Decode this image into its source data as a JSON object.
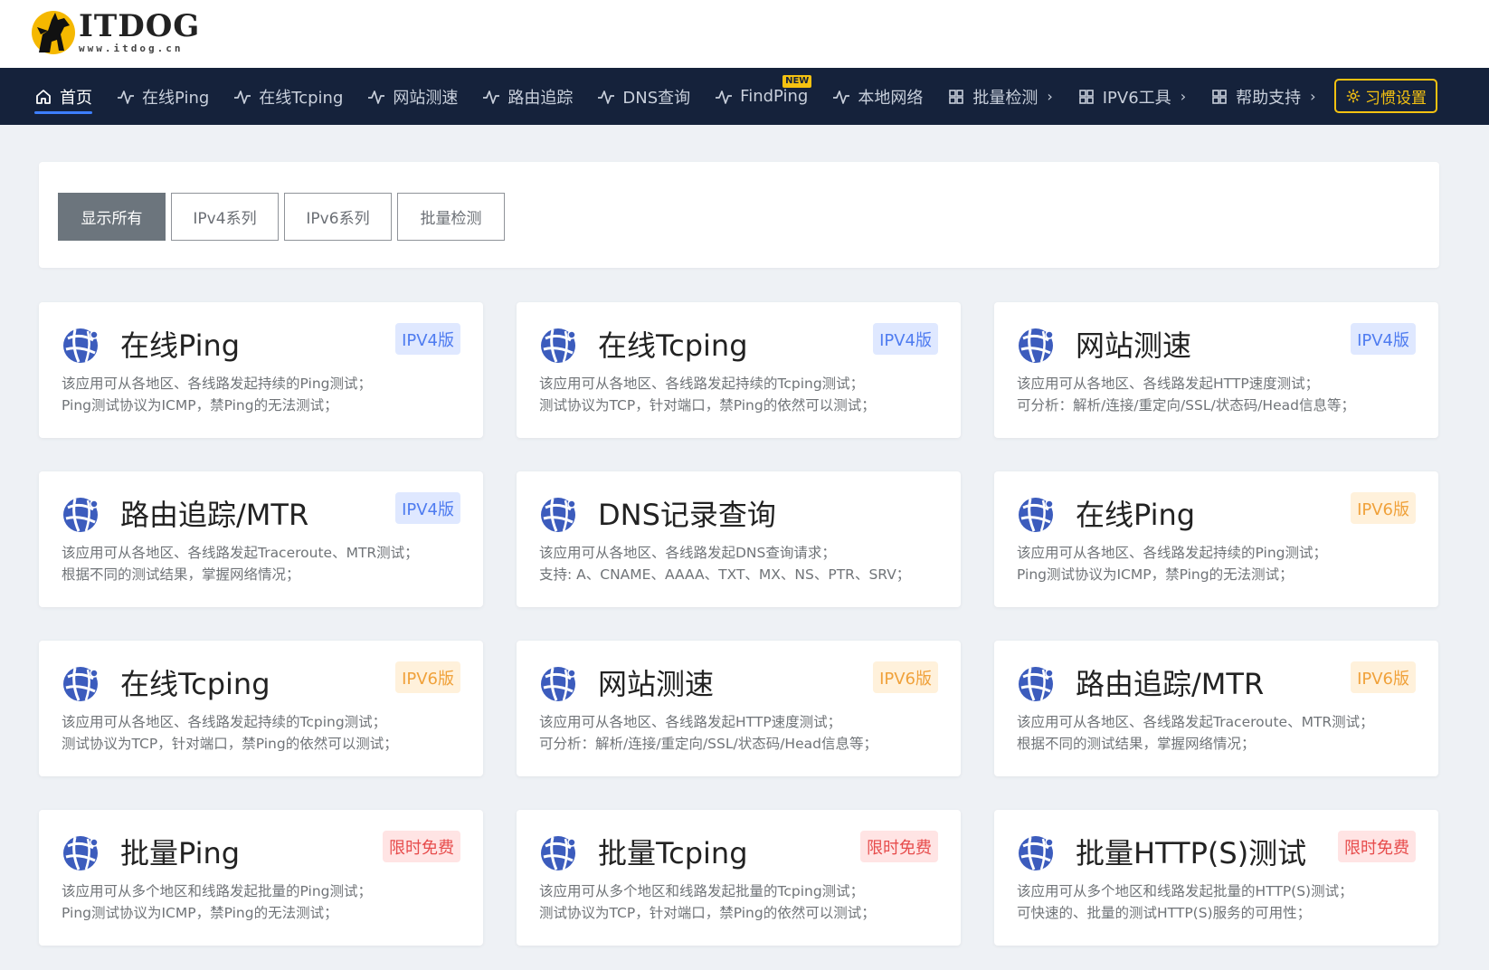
{
  "logo": {
    "name": "ITDOG",
    "domain": "www.itdog.cn"
  },
  "nav": {
    "items": [
      {
        "label": "首页",
        "icon": "home-icon",
        "active": true
      },
      {
        "label": "在线Ping",
        "icon": "pulse-icon"
      },
      {
        "label": "在线Tcping",
        "icon": "pulse-icon"
      },
      {
        "label": "网站测速",
        "icon": "pulse-icon"
      },
      {
        "label": "路由追踪",
        "icon": "pulse-icon"
      },
      {
        "label": "DNS查询",
        "icon": "pulse-icon"
      },
      {
        "label": "FindPing",
        "icon": "pulse-icon",
        "badge": "NEW"
      },
      {
        "label": "本地网络",
        "icon": "pulse-icon"
      },
      {
        "label": "批量检测",
        "icon": "grid-icon",
        "chevron": "›"
      },
      {
        "label": "IPV6工具",
        "icon": "grid-icon",
        "chevron": "›"
      },
      {
        "label": "帮助支持",
        "icon": "grid-icon",
        "chevron": "›"
      }
    ],
    "settings_label": "习惯设置",
    "colors": {
      "bg": "#15223b",
      "accent": "#f5c211",
      "active_underline": "#3d7fff"
    }
  },
  "filters": [
    "显示所有",
    "IPv4系列",
    "IPv6系列",
    "批量检测"
  ],
  "cards": [
    {
      "title": "在线Ping",
      "badge": "IPV4版",
      "type": "v4",
      "desc": [
        "该应用可从各地区、各线路发起持续的Ping测试；",
        "Ping测试协议为ICMP，禁Ping的无法测试；"
      ]
    },
    {
      "title": "在线Tcping",
      "badge": "IPV4版",
      "type": "v4",
      "desc": [
        "该应用可从各地区、各线路发起持续的Tcping测试；",
        "测试协议为TCP，针对端口，禁Ping的依然可以测试；"
      ]
    },
    {
      "title": "网站测速",
      "badge": "IPV4版",
      "type": "v4",
      "desc": [
        "该应用可从各地区、各线路发起HTTP速度测试；",
        "可分析：解析/连接/重定向/SSL/状态码/Head信息等；"
      ]
    },
    {
      "title": "路由追踪/MTR",
      "badge": "IPV4版",
      "type": "v4",
      "desc": [
        "该应用可从各地区、各线路发起Traceroute、MTR测试；",
        "根据不同的测试结果，掌握网络情况；"
      ]
    },
    {
      "title": "DNS记录查询",
      "badge": "",
      "type": "none",
      "desc": [
        "该应用可从各地区、各线路发起DNS查询请求；",
        "支持: A、CNAME、AAAA、TXT、MX、NS、PTR、SRV；"
      ]
    },
    {
      "title": "在线Ping",
      "badge": "IPV6版",
      "type": "v6",
      "desc": [
        "该应用可从各地区、各线路发起持续的Ping测试；",
        "Ping测试协议为ICMP，禁Ping的无法测试；"
      ]
    },
    {
      "title": "在线Tcping",
      "badge": "IPV6版",
      "type": "v6",
      "desc": [
        "该应用可从各地区、各线路发起持续的Tcping测试；",
        "测试协议为TCP，针对端口，禁Ping的依然可以测试；"
      ]
    },
    {
      "title": "网站测速",
      "badge": "IPV6版",
      "type": "v6",
      "desc": [
        "该应用可从各地区、各线路发起HTTP速度测试；",
        "可分析：解析/连接/重定向/SSL/状态码/Head信息等；"
      ]
    },
    {
      "title": "路由追踪/MTR",
      "badge": "IPV6版",
      "type": "v6",
      "desc": [
        "该应用可从各地区、各线路发起Traceroute、MTR测试；",
        "根据不同的测试结果，掌握网络情况；"
      ]
    },
    {
      "title": "批量Ping",
      "badge": "限时免费",
      "type": "free",
      "desc": [
        "该应用可从多个地区和线路发起批量的Ping测试；",
        "Ping测试协议为ICMP，禁Ping的无法测试；"
      ]
    },
    {
      "title": "批量Tcping",
      "badge": "限时免费",
      "type": "free",
      "desc": [
        "该应用可从多个地区和线路发起批量的Tcping测试；",
        "测试协议为TCP，针对端口，禁Ping的依然可以测试；"
      ]
    },
    {
      "title": "批量HTTP(S)测试",
      "badge": "限时免费",
      "type": "free",
      "desc": [
        "该应用可从多个地区和线路发起批量的HTTP(S)测试；",
        "可快速的、批量的测试HTTP(S)服务的可用性；"
      ]
    }
  ]
}
